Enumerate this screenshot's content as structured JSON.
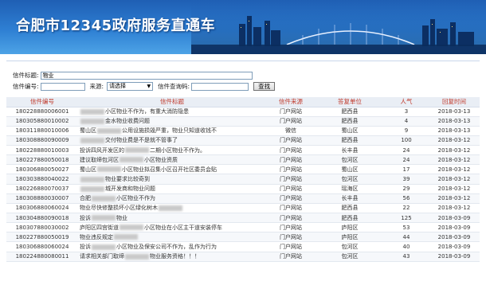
{
  "banner": {
    "title": "合肥市12345政府服务直通车"
  },
  "search": {
    "subject_label": "信件标题:",
    "subject_value": "物业",
    "code_label": "信件编号:",
    "code_value": "",
    "source_label": "来源:",
    "source_selected": "请选择",
    "query_code_label": "信件查询码:",
    "query_code_value": "",
    "search_button": "查找"
  },
  "table": {
    "headers": [
      "信件编号",
      "信件标题",
      "信件来源",
      "答复单位",
      "人气",
      "回复时间"
    ],
    "rows": [
      {
        "code": "180228880006001",
        "title_a": "",
        "title_b": "小区物业不作为，有重大消防隐患",
        "source": "门户网站",
        "unit": "肥西县",
        "hits": "3",
        "date": "2018-03-13"
      },
      {
        "code": "180305880010002",
        "title_a": "",
        "title_b": "金水物业收费问题",
        "source": "门户网站",
        "unit": "肥西县",
        "hits": "4",
        "date": "2018-03-13"
      },
      {
        "code": "180311880010006",
        "title_a": "蜀山区",
        "title_b": "公用设施损毁严重，物业只知道收钱不",
        "source": "微信",
        "unit": "蜀山区",
        "hits": "9",
        "date": "2018-03-13"
      },
      {
        "code": "180308880090009",
        "title_a": "",
        "title_b": "交付物业费是不是就不管事了",
        "source": "门户网站",
        "unit": "肥西县",
        "hits": "100",
        "date": "2018-03-12"
      },
      {
        "code": "180228880010003",
        "title_a": "投诉四风开发区的",
        "title_b": "二期小区物业不作为。",
        "source": "门户网站",
        "unit": "长丰县",
        "hits": "24",
        "date": "2018-03-12"
      },
      {
        "code": "180227880050018",
        "title_a": "建议取缔包河区",
        "title_b": "小区物业资质",
        "source": "门户网站",
        "unit": "包河区",
        "hits": "24",
        "date": "2018-03-12"
      },
      {
        "code": "180306880050027",
        "title_a": "蜀山区",
        "title_b": "小区物业拟召集小区召开社区委员会贴",
        "source": "门户网站",
        "unit": "蜀山区",
        "hits": "17",
        "date": "2018-03-12"
      },
      {
        "code": "180303880040022",
        "title_a": "",
        "title_b": "物业要求比较奇到",
        "source": "门户网站",
        "unit": "包河区",
        "hits": "39",
        "date": "2018-03-12"
      },
      {
        "code": "180226880070037",
        "title_a": "",
        "title_b": "城开发商和物业问题",
        "source": "门户网站",
        "unit": "瑶海区",
        "hits": "29",
        "date": "2018-03-12"
      },
      {
        "code": "180308880030007",
        "title_a": "合肥",
        "title_b": "小区物业不作为",
        "source": "门户网站",
        "unit": "长丰县",
        "hits": "56",
        "date": "2018-03-12"
      },
      {
        "code": "180306880060024",
        "title_a": "物业尽快修整损坏小区绿化树木",
        "title_b": "",
        "source": "门户网站",
        "unit": "肥西县",
        "hits": "22",
        "date": "2018-03-12"
      },
      {
        "code": "180304880090018",
        "title_a": "投诉",
        "title_b": "物业",
        "source": "门户网站",
        "unit": "肥西县",
        "hits": "125",
        "date": "2018-03-09"
      },
      {
        "code": "180307880030002",
        "title_a": "庐阳区四宫街道",
        "title_b": "小区物业在小区主干道安装停车",
        "source": "门户网站",
        "unit": "庐阳区",
        "hits": "53",
        "date": "2018-03-09"
      },
      {
        "code": "180227880050019",
        "title_a": "物业违反规定",
        "title_b": "",
        "source": "门户网站",
        "unit": "庐阳区",
        "hits": "44",
        "date": "2018-03-09"
      },
      {
        "code": "180306880060024",
        "title_a": "投诉",
        "title_b": "小区物业及保安公司不作为，乱作为行为",
        "source": "门户网站",
        "unit": "包河区",
        "hits": "40",
        "date": "2018-03-09"
      },
      {
        "code": "180224880080011",
        "title_a": "请求相关部门取缔",
        "title_b": "物业服务资格！！！",
        "source": "门户网站",
        "unit": "包河区",
        "hits": "43",
        "date": "2018-03-09"
      }
    ]
  },
  "colors": {
    "banner_blue": "#2e7fd3",
    "header_text": "#c0392b"
  }
}
